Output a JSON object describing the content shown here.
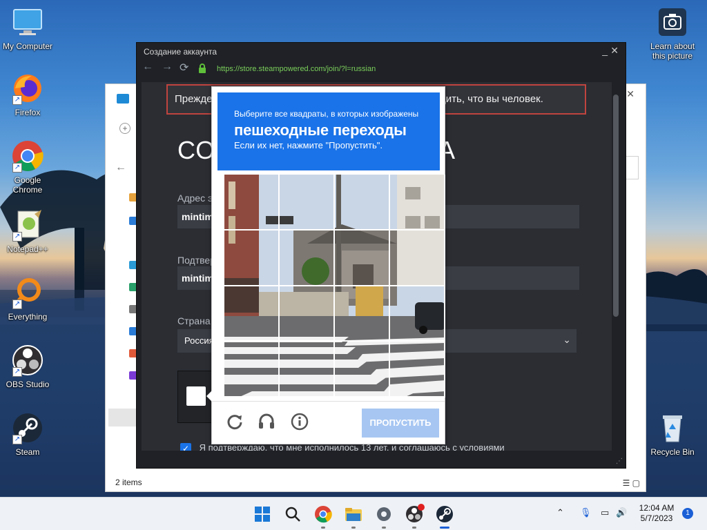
{
  "desktop": {
    "icons": [
      {
        "label": "My Computer",
        "icon": "computer-icon"
      },
      {
        "label": "Firefox",
        "icon": "firefox-icon"
      },
      {
        "label": "Google Chrome",
        "icon": "chrome-icon"
      },
      {
        "label": "Notepad++",
        "icon": "notepadpp-icon"
      },
      {
        "label": "Everything",
        "icon": "everything-icon"
      },
      {
        "label": "OBS Studio",
        "icon": "obs-icon"
      },
      {
        "label": "Steam",
        "icon": "steam-icon"
      }
    ],
    "right_icons": [
      {
        "label": "Learn about this picture",
        "icon": "camera-icon"
      },
      {
        "label": "Recycle Bin",
        "icon": "recycle-bin-icon"
      }
    ]
  },
  "explorer": {
    "status": "2 items"
  },
  "steam_window": {
    "title": "Создание аккаунта",
    "url": "https://store.steampowered.com/join/?l=russian",
    "warning_start": "Прежде",
    "warning_end": "рдить, что вы человек.",
    "title_start": "СО",
    "title_end": "А",
    "email_label": "Адрес э",
    "email_value": "mintim",
    "confirm_label": "Подтвер",
    "confirm_value": "mintim",
    "country_label": "Страна",
    "country_value": "Россия",
    "agree_text": "Я подтверждаю, что мне исполнилось 13 лет, и соглашаюсь с условиями"
  },
  "captcha": {
    "instruction": "Выберите все квадраты, в которых изображены",
    "target": "пешеходные переходы",
    "note": "Если их нет, нажмите \"Пропустить\".",
    "skip_label": "ПРОПУСТИТЬ",
    "grid_rows": 4,
    "grid_cols": 4
  },
  "taskbar": {
    "apps": [
      "windows-start-icon",
      "search-icon",
      "chrome-icon",
      "file-explorer-icon",
      "settings-icon",
      "obs-icon",
      "steam-icon"
    ],
    "time": "12:04 AM",
    "date": "5/7/2023",
    "notification_count": "1"
  },
  "colors": {
    "captcha_blue": "#1a73e8",
    "skip_disabled": "#a7c6f2",
    "steam_bg": "#1f2126",
    "warning_border": "#c1443e",
    "url_green": "#7bcf5a"
  }
}
